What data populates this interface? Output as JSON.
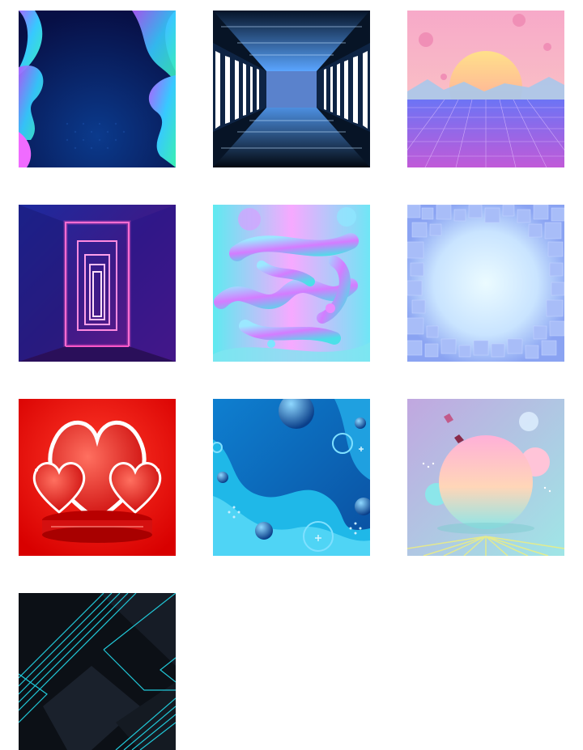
{
  "gallery": {
    "items": [
      {
        "id": "liquid-neon-waves",
        "icon": "abstract-fluid-image",
        "colors": [
          "#0a1a5c",
          "#32c6ff",
          "#b36bff",
          "#3fe0c5"
        ]
      },
      {
        "id": "neon-corridor-blue",
        "icon": "corridor-image",
        "colors": [
          "#05101f",
          "#4d8fe0",
          "#ffffff"
        ]
      },
      {
        "id": "synthwave-sunset",
        "icon": "landscape-image",
        "colors": [
          "#f9b3c6",
          "#ffd08a",
          "#7a6cf5"
        ]
      },
      {
        "id": "neon-tunnel-pink",
        "icon": "tunnel-image",
        "colors": [
          "#1a1470",
          "#ff57c8",
          "#6a2cc9"
        ]
      },
      {
        "id": "holographic-fluid",
        "icon": "abstract-fluid-image",
        "colors": [
          "#45e6f0",
          "#f6a8ff",
          "#8fd8ff"
        ]
      },
      {
        "id": "cube-frame-blue",
        "icon": "cube-frame-image",
        "colors": [
          "#8aa6f5",
          "#dff4ff"
        ]
      },
      {
        "id": "valentine-hearts-podium",
        "icon": "hearts-image",
        "colors": [
          "#e00a0a",
          "#ff4a3d",
          "#ffffff"
        ]
      },
      {
        "id": "blue-fluid-spheres",
        "icon": "spheres-image",
        "colors": [
          "#0a6fc7",
          "#26c8ee",
          "#5bd6ff"
        ]
      },
      {
        "id": "pastel-sphere",
        "icon": "sphere-image",
        "colors": [
          "#b8a7e6",
          "#ffc6d8",
          "#8ce6e9"
        ]
      },
      {
        "id": "dark-cyan-geometry",
        "icon": "geometric-image",
        "colors": [
          "#0c1016",
          "#21c8d8",
          "#1c2430"
        ]
      }
    ]
  }
}
